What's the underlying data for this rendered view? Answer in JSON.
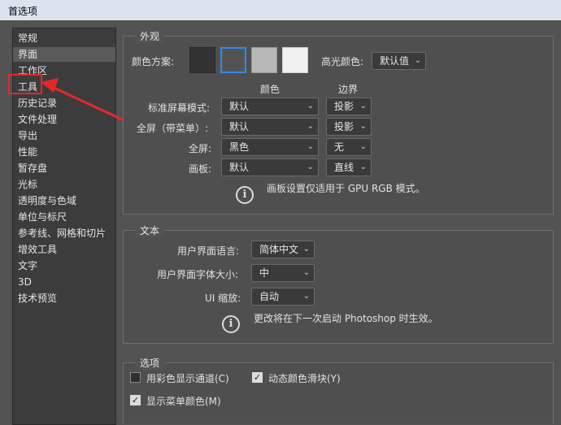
{
  "window": {
    "title": "首选项"
  },
  "sidebar": {
    "items": [
      {
        "label": "常规"
      },
      {
        "label": "界面"
      },
      {
        "label": "工作区"
      },
      {
        "label": "工具"
      },
      {
        "label": "历史记录"
      },
      {
        "label": "文件处理"
      },
      {
        "label": "导出"
      },
      {
        "label": "性能"
      },
      {
        "label": "暂存盘"
      },
      {
        "label": "光标"
      },
      {
        "label": "透明度与色域"
      },
      {
        "label": "单位与标尺"
      },
      {
        "label": "参考线、网格和切片"
      },
      {
        "label": "增效工具"
      },
      {
        "label": "文字"
      },
      {
        "label": "3D"
      },
      {
        "label": "技术预览"
      }
    ],
    "selected": "界面",
    "annotated": "工具"
  },
  "appearance": {
    "title": "外观",
    "color_scheme_label": "颜色方案:",
    "swatch_colors": [
      "#323232",
      "#535353",
      "#b8b8b8",
      "#f0f0f0"
    ],
    "highlight_label": "高光颜色:",
    "highlight_value": "默认值",
    "col_color": "颜色",
    "col_border": "边界",
    "rows": [
      {
        "label": "标准屏幕模式:",
        "color": "默认",
        "border": "投影"
      },
      {
        "label": "全屏（带菜单）:",
        "color": "默认",
        "border": "投影"
      },
      {
        "label": "全屏:",
        "color": "黑色",
        "border": "无"
      },
      {
        "label": "画板:",
        "color": "默认",
        "border": "直线"
      }
    ],
    "note": "画板设置仅适用于 GPU RGB 模式。"
  },
  "text": {
    "title": "文本",
    "lang_label": "用户界面语言:",
    "lang_value": "简体中文",
    "size_label": "用户界面字体大小:",
    "size_value": "中",
    "scale_label": "UI 缩放:",
    "scale_value": "自动",
    "note": "更改将在下一次启动 Photoshop 时生效。"
  },
  "options": {
    "title": "选项",
    "channels_label": "用彩色显示通道(C)",
    "channels_checked": false,
    "dynamic_label": "动态颜色滑块(Y)",
    "dynamic_checked": true,
    "menu_color_label": "显示菜单颜色(M)",
    "menu_color_checked": true
  },
  "colors": {
    "annotation_red": "#e7262a",
    "selected_swatch_border": "#2d8ceb"
  }
}
